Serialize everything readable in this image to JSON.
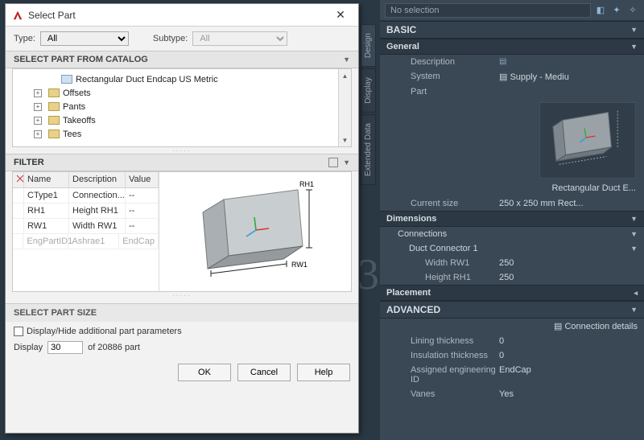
{
  "dialog": {
    "title": "Select Part",
    "type_label": "Type:",
    "type_value": "All",
    "subtype_label": "Subtype:",
    "subtype_value": "All",
    "catalog_header": "SELECT PART FROM CATALOG",
    "tree": [
      {
        "label": "Rectangular Duct Endcap US Metric",
        "kind": "part"
      },
      {
        "label": "Offsets",
        "kind": "folder"
      },
      {
        "label": "Pants",
        "kind": "folder"
      },
      {
        "label": "Takeoffs",
        "kind": "folder"
      },
      {
        "label": "Tees",
        "kind": "folder"
      }
    ],
    "filter_header": "FILTER",
    "filter_cols": {
      "name": "Name",
      "desc": "Description",
      "value": "Value"
    },
    "filter_rows": [
      {
        "name": "CType1",
        "desc": "Connection...",
        "value": "--"
      },
      {
        "name": "RH1",
        "desc": "Height RH1",
        "value": "--"
      },
      {
        "name": "RW1",
        "desc": "Width RW1",
        "value": "--"
      },
      {
        "name": "EngPartID1",
        "desc": "Ashrae1",
        "value": "EndCap",
        "dim": true
      }
    ],
    "preview_labels": {
      "rh": "RH1",
      "rw": "RW1"
    },
    "sps_header": "SELECT PART SIZE",
    "addl_label": "Display/Hide additional part parameters",
    "display_label": "Display",
    "display_value": "30",
    "display_suffix": "of 20886 part",
    "buttons": {
      "ok": "OK",
      "cancel": "Cancel",
      "help": "Help"
    }
  },
  "mep": {
    "no_selection": "No selection",
    "tabs": {
      "design": "Design",
      "display": "Display",
      "extdata": "Extended Data"
    },
    "basic": "BASIC",
    "general": "General",
    "rows": {
      "description": "Description",
      "description_val": "",
      "system": "System",
      "system_val": "Supply - Mediu",
      "part": "Part",
      "part_caption": "Rectangular Duct E...",
      "current_size": "Current size",
      "current_size_val": "250 x 250 mm Rect..."
    },
    "dimensions": "Dimensions",
    "connections": "Connections",
    "duct_conn": "Duct Connector 1",
    "width_rw1": "Width RW1",
    "width_rw1_val": "250",
    "height_rh1": "Height RH1",
    "height_rh1_val": "250",
    "placement": "Placement",
    "advanced": "ADVANCED",
    "conn_details": "Connection details",
    "lining": "Lining thickness",
    "lining_val": "0",
    "insulation": "Insulation thickness",
    "insulation_val": "0",
    "eng_id": "Assigned engineering ID",
    "eng_id_val": "EndCap",
    "vanes": "Vanes",
    "vanes_val": "Yes"
  }
}
